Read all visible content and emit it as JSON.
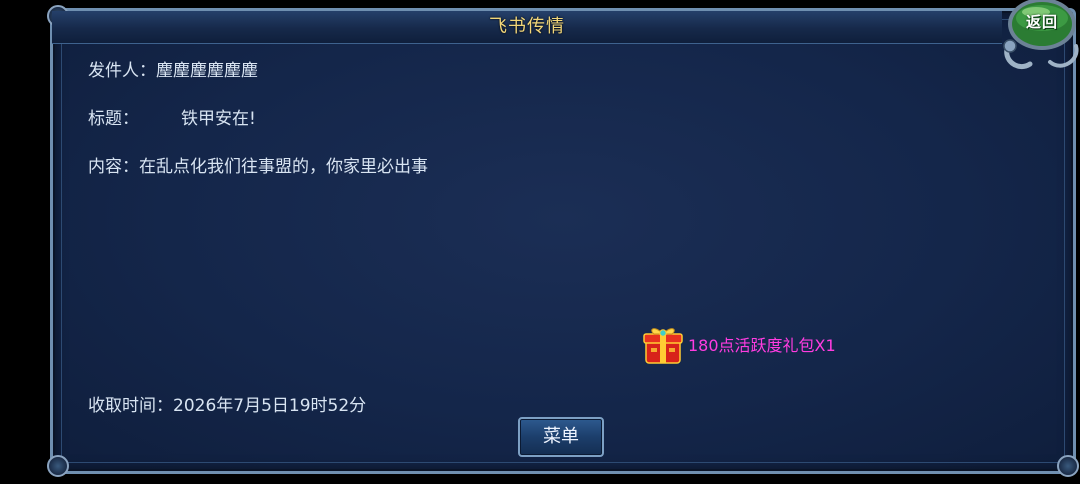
{
  "window": {
    "title": "飞书传情"
  },
  "mail": {
    "sender_label": "发件人：",
    "sender_value": "麈麈麈麈麈麈",
    "subject_label": "标题：",
    "subject_value": "铁甲安在!",
    "content_label": "内容：",
    "content_value": "在乱点化我们往事盟的，你家里必出事",
    "received_label": "收取时间：",
    "received_value": "2026年7月5日19时52分"
  },
  "reward": {
    "icon": "gift-box-icon",
    "text": "180点活跃度礼包X1"
  },
  "buttons": {
    "menu_label": "菜单",
    "return_label": "返回"
  },
  "colors": {
    "title": "#f2d77a",
    "reward_text": "#ff3ce0",
    "panel_bg": "#14264a",
    "return_orb": "#2f8a36"
  }
}
